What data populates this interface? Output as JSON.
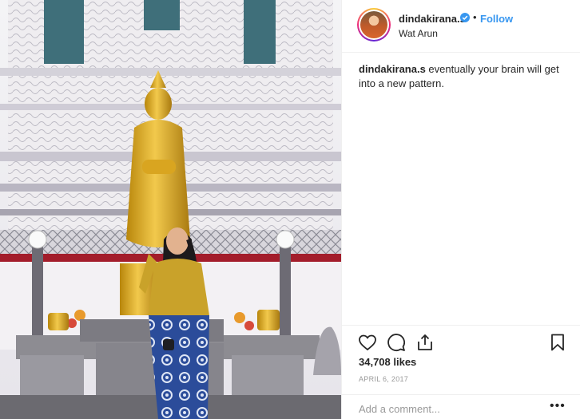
{
  "post": {
    "username": "dindakirana.s",
    "dot": "•",
    "follow_label": "Follow",
    "location": "Wat Arun",
    "caption_user": "dindakirana.s",
    "caption_text": " eventually your brain will get into a new pattern.",
    "likes": "34,708 likes",
    "date": "APRIL 6, 2017",
    "comment_placeholder": "Add a comment...",
    "more": "•••"
  },
  "icons": {
    "verified": "verified-badge-icon",
    "like": "heart-icon",
    "comment": "comment-bubble-icon",
    "share": "share-icon",
    "save": "bookmark-icon",
    "more": "more-options-icon"
  },
  "colors": {
    "link": "#3897f0",
    "text": "#262626",
    "muted": "#999999",
    "border": "#efefef"
  }
}
